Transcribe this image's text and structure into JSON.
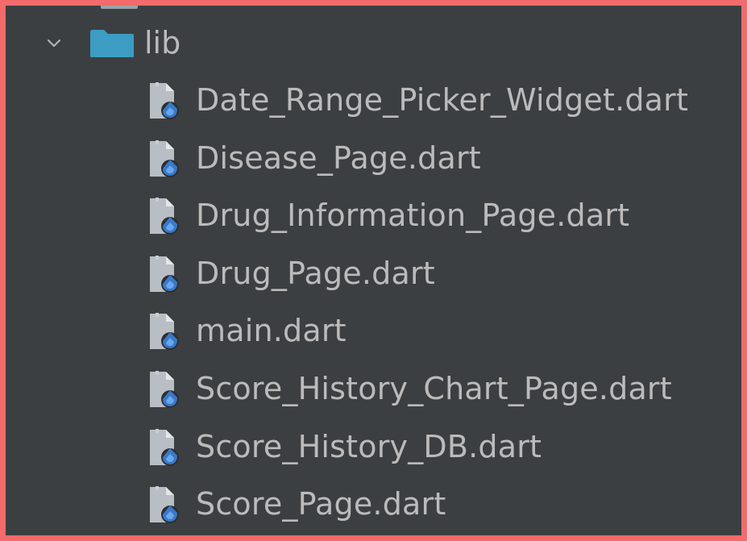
{
  "colors": {
    "frame_border": "#f36b6b",
    "panel_background": "#3c3f41",
    "text": "#bbbbbb",
    "folder": "#3d9cc4",
    "file_doc": "#b8bec4",
    "dart_badge": "#3a79c9"
  },
  "tree": {
    "folder": {
      "label": "lib",
      "expanded": true,
      "chevron_icon": "chevron-down-icon",
      "icon": "folder-icon"
    },
    "files": [
      {
        "label": "Date_Range_Picker_Widget.dart",
        "icon": "dart-file-icon"
      },
      {
        "label": "Disease_Page.dart",
        "icon": "dart-file-icon"
      },
      {
        "label": "Drug_Information_Page.dart",
        "icon": "dart-file-icon"
      },
      {
        "label": "Drug_Page.dart",
        "icon": "dart-file-icon"
      },
      {
        "label": "main.dart",
        "icon": "dart-file-icon"
      },
      {
        "label": "Score_History_Chart_Page.dart",
        "icon": "dart-file-icon"
      },
      {
        "label": "Score_History_DB.dart",
        "icon": "dart-file-icon"
      },
      {
        "label": "Score_Page.dart",
        "icon": "dart-file-icon"
      }
    ]
  }
}
